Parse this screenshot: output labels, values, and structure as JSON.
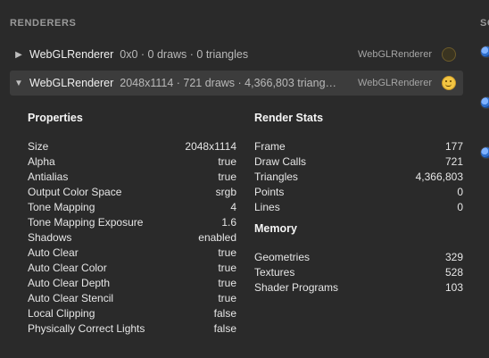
{
  "panel": {
    "title": "RENDERERS",
    "right_title": "SC"
  },
  "renderers": [
    {
      "name": "WebGLRenderer",
      "info": "0x0 · 0 draws · 0 triangles",
      "type": "WebGLRenderer",
      "expanded": false,
      "icon": "emoji-face-icon"
    },
    {
      "name": "WebGLRenderer",
      "info": "2048x1114 · 721 draws · 4,366,803 triang…",
      "type": "WebGLRenderer",
      "expanded": true,
      "icon": "emoji-face-icon"
    }
  ],
  "properties": {
    "title": "Properties",
    "items": [
      {
        "k": "Size",
        "v": "2048x1114"
      },
      {
        "k": "Alpha",
        "v": "true"
      },
      {
        "k": "Antialias",
        "v": "true"
      },
      {
        "k": "Output Color Space",
        "v": "srgb"
      },
      {
        "k": "Tone Mapping",
        "v": "4"
      },
      {
        "k": "Tone Mapping Exposure",
        "v": "1.6"
      },
      {
        "k": "Shadows",
        "v": "enabled"
      },
      {
        "k": "Auto Clear",
        "v": "true"
      },
      {
        "k": "Auto Clear Color",
        "v": "true"
      },
      {
        "k": "Auto Clear Depth",
        "v": "true"
      },
      {
        "k": "Auto Clear Stencil",
        "v": "true"
      },
      {
        "k": "Local Clipping",
        "v": "false"
      },
      {
        "k": "Physically Correct Lights",
        "v": "false"
      }
    ]
  },
  "render_stats": {
    "title": "Render Stats",
    "items": [
      {
        "k": "Frame",
        "v": "177"
      },
      {
        "k": "Draw Calls",
        "v": "721"
      },
      {
        "k": "Triangles",
        "v": "4,366,803"
      },
      {
        "k": "Points",
        "v": "0"
      },
      {
        "k": "Lines",
        "v": "0"
      }
    ]
  },
  "memory": {
    "title": "Memory",
    "items": [
      {
        "k": "Geometries",
        "v": "329"
      },
      {
        "k": "Textures",
        "v": "528"
      },
      {
        "k": "Shader Programs",
        "v": "103"
      }
    ]
  }
}
